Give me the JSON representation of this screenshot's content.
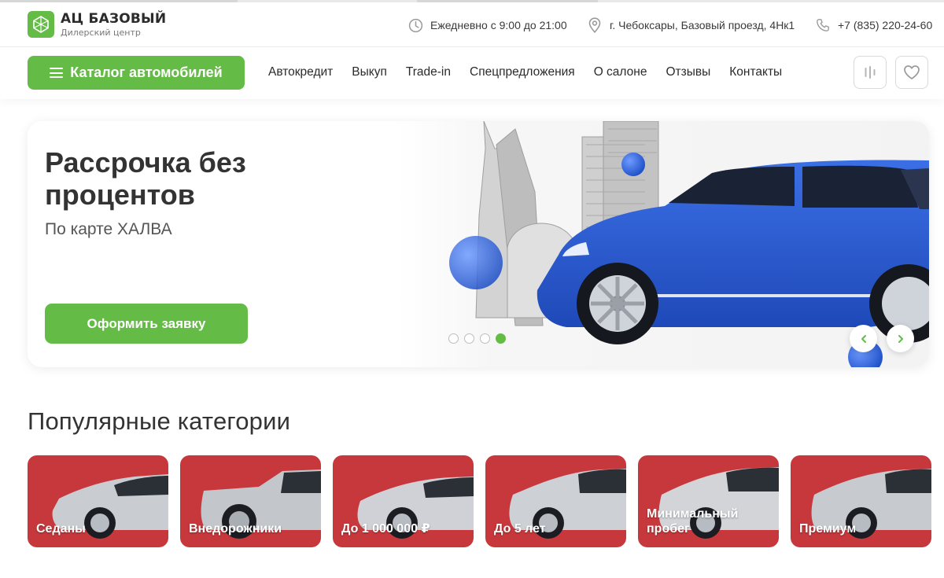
{
  "brand": {
    "title": "АЦ БАЗОВЫЙ",
    "subtitle": "Дилерский центр",
    "accent": "#64bc46"
  },
  "contacts": {
    "hours": "Ежедневно с 9:00 до 21:00",
    "address": "г. Чебоксары, Базовый проезд, 4Нк1",
    "phone": "+7 (835) 220-24-60"
  },
  "nav": {
    "catalog_label": "Каталог автомобилей",
    "links": [
      "Автокредит",
      "Выкуп",
      "Trade-in",
      "Спецпредложения",
      "О салоне",
      "Отзывы",
      "Контакты"
    ],
    "icons": [
      "compare-icon",
      "heart-icon"
    ]
  },
  "hero": {
    "title": "Рассрочка без процентов",
    "subtitle": "По карте ХАЛВА",
    "cta": "Оформить заявку",
    "slides_total": 4,
    "active_slide": 4,
    "car_color": "#2f5fd3"
  },
  "categories": {
    "title": "Популярные категории",
    "card_color": "#c7383d",
    "items": [
      "Седаны",
      "Внедорожники",
      "До 1 000 000 ₽",
      "До 5 лет",
      "Минимальный пробег",
      "Премиум"
    ]
  }
}
